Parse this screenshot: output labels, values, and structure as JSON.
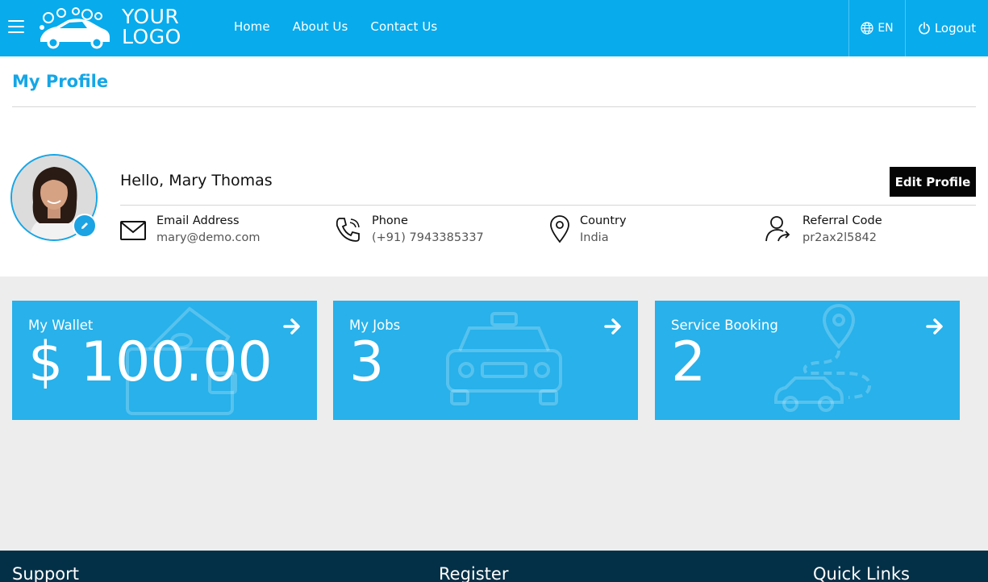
{
  "header": {
    "logo_line1": "YOUR",
    "logo_line2": "LOGO",
    "nav": [
      {
        "label": "Home"
      },
      {
        "label": "About Us"
      },
      {
        "label": "Contact Us"
      }
    ],
    "language": "EN",
    "logout": "Logout"
  },
  "profile": {
    "page_title": "My Profile",
    "greeting": "Hello, Mary Thomas",
    "edit_button": "Edit Profile",
    "fields": [
      {
        "label": "Email Address",
        "value": "mary@demo.com"
      },
      {
        "label": "Phone",
        "value": "(+91) 7943385337"
      },
      {
        "label": "Country",
        "value": "India"
      },
      {
        "label": "Referral Code",
        "value": "pr2ax2l5842"
      }
    ]
  },
  "cards": [
    {
      "title": "My Wallet",
      "value": "$ 100.00"
    },
    {
      "title": "My Jobs",
      "value": "3"
    },
    {
      "title": "Service Booking",
      "value": "2"
    }
  ],
  "footer": {
    "headings": [
      "Support",
      "Register",
      "Quick Links"
    ]
  },
  "colors": {
    "header": "#08abec",
    "accent": "#15a6e6",
    "card": "#28b1ea",
    "footer": "#043047"
  }
}
